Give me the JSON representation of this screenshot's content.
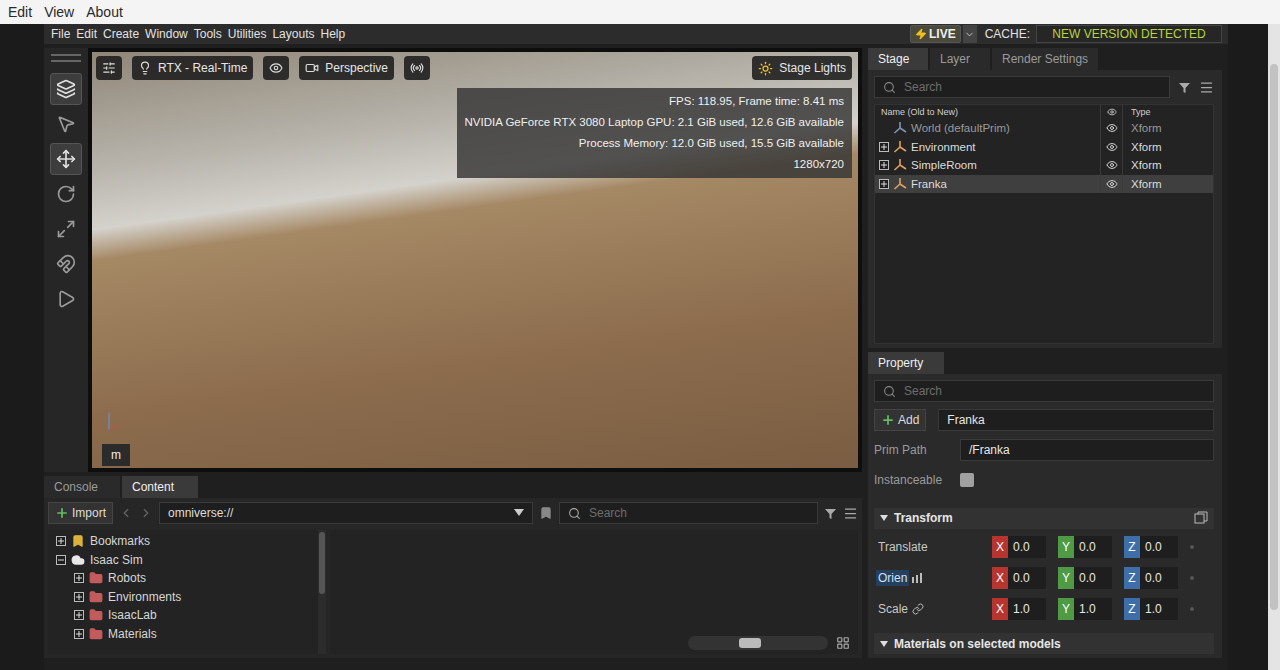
{
  "os_menu": [
    "Edit",
    "View",
    "About"
  ],
  "menu": [
    "File",
    "Edit",
    "Create",
    "Window",
    "Tools",
    "Utilities",
    "Layouts",
    "Help"
  ],
  "live": {
    "label": "LIVE",
    "on": true
  },
  "cache": {
    "label": "CACHE:",
    "status": "NEW VERSION DETECTED"
  },
  "tools": [
    {
      "kind": "layers",
      "selected": true
    },
    {
      "kind": "select",
      "selected": false
    },
    {
      "kind": "move",
      "selected": true
    },
    {
      "kind": "rotate",
      "selected": false
    },
    {
      "kind": "scale",
      "selected": false
    },
    {
      "kind": "snap",
      "selected": false
    },
    {
      "kind": "play",
      "selected": false
    }
  ],
  "viewport": {
    "renderer": "RTX - Real-Time",
    "camera": "Perspective",
    "lights": "Stage Lights",
    "stats": [
      "FPS: 118.95, Frame time: 8.41 ms",
      "NVIDIA GeForce RTX 3080 Laptop GPU: 2.1 GiB used, 12.6 GiB available",
      "Process Memory: 12.0 GiB used, 15.5 GiB available",
      "1280x720"
    ],
    "unit": "m"
  },
  "stage": {
    "tabs": [
      {
        "label": "Stage",
        "selected": true
      },
      {
        "label": "Layer",
        "selected": false
      },
      {
        "label": "Render Settings",
        "selected": false
      }
    ],
    "search": {
      "placeholder": "Search"
    },
    "columns": {
      "name": "Name (Old to New)",
      "type": "Type"
    },
    "rows": [
      {
        "name": "World (defaultPrim)",
        "type": "Xform",
        "expandable": false,
        "selected": false,
        "visible": true,
        "dimmed": true
      },
      {
        "name": "Environment",
        "type": "Xform",
        "expandable": true,
        "selected": false,
        "visible": true,
        "dimmed": false
      },
      {
        "name": "SimpleRoom",
        "type": "Xform",
        "expandable": true,
        "selected": false,
        "visible": true,
        "dimmed": false
      },
      {
        "name": "Franka",
        "type": "Xform",
        "expandable": true,
        "selected": true,
        "visible": true,
        "dimmed": false
      }
    ]
  },
  "property": {
    "tab": "Property",
    "search": {
      "placeholder": "Search"
    },
    "add": "Add",
    "name": "Franka",
    "prim_path_label": "Prim Path",
    "prim_path": "/Franka",
    "instanceable_label": "Instanceable",
    "instanceable": false,
    "transform": {
      "label": "Transform",
      "expanded": true,
      "rows": [
        {
          "label": "Translate",
          "highlighted": false,
          "kind": "plain",
          "values": [
            {
              "axis": "X",
              "value": "0.0",
              "color": "#b8352f"
            },
            {
              "axis": "Y",
              "value": "0.0",
              "color": "#4e9a45"
            },
            {
              "axis": "Z",
              "value": "0.0",
              "color": "#3e6ea8"
            }
          ]
        },
        {
          "label": "Orien",
          "highlighted": true,
          "kind": "orient",
          "values": [
            {
              "axis": "X",
              "value": "0.0",
              "color": "#b8352f"
            },
            {
              "axis": "Y",
              "value": "0.0",
              "color": "#4e9a45"
            },
            {
              "axis": "Z",
              "value": "0.0",
              "color": "#3e6ea8"
            }
          ]
        },
        {
          "label": "Scale",
          "highlighted": false,
          "kind": "scale",
          "values": [
            {
              "axis": "X",
              "value": "1.0",
              "color": "#b8352f"
            },
            {
              "axis": "Y",
              "value": "1.0",
              "color": "#4e9a45"
            },
            {
              "axis": "Z",
              "value": "1.0",
              "color": "#3e6ea8"
            }
          ]
        }
      ]
    },
    "next_section": {
      "label": "Materials on selected models",
      "expanded": true
    }
  },
  "browser": {
    "tabs": [
      {
        "label": "Console",
        "selected": false
      },
      {
        "label": "Content",
        "selected": true
      }
    ],
    "import": "Import",
    "path": "omniverse://",
    "search": {
      "placeholder": "Search"
    },
    "tree": [
      {
        "label": "Bookmarks",
        "kind": "bookmark",
        "depth": 0,
        "expanded": false
      },
      {
        "label": "Isaac Sim",
        "kind": "cloud",
        "depth": 0,
        "expanded": true
      },
      {
        "label": "Robots",
        "kind": "folder",
        "depth": 1,
        "expanded": false
      },
      {
        "label": "Environments",
        "kind": "folder",
        "depth": 1,
        "expanded": false
      },
      {
        "label": "IsaacLab",
        "kind": "folder",
        "depth": 1,
        "expanded": false
      },
      {
        "label": "Materials",
        "kind": "folder",
        "depth": 1,
        "expanded": false
      }
    ],
    "zoom": {
      "level": 0.43
    }
  }
}
